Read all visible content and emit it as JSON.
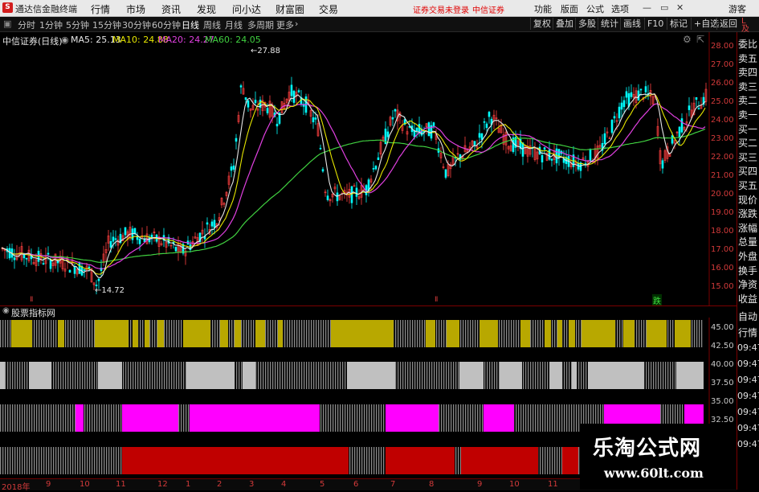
{
  "window": {
    "app_title": "通达信金融终端",
    "menu": [
      "行情",
      "市场",
      "资讯",
      "发现",
      "问小达",
      "财富圈",
      "交易"
    ],
    "notice": "证券交易未登录",
    "broker": "中信证券",
    "right_menu": [
      "功能",
      "版面",
      "公式",
      "选项"
    ],
    "user": "游客"
  },
  "toolbar": {
    "periods": [
      "分时",
      "1分钟",
      "5分钟",
      "15分钟",
      "30分钟",
      "60分钟",
      "日线",
      "周线",
      "月线",
      "多周期",
      "更多"
    ],
    "active_period": "日线",
    "right_buttons": [
      "复权",
      "叠加",
      "多股",
      "统计",
      "画线",
      "F10",
      "标记",
      "+自选",
      "返回"
    ]
  },
  "chart_header": {
    "stock": "中信证券(日线)",
    "ma": [
      {
        "label": "MA5: 25.13",
        "color": "#e6e6e6"
      },
      {
        "label": "MA10: 24.88",
        "color": "#e6e600"
      },
      {
        "label": "MA20: 24.27",
        "color": "#e040e0"
      },
      {
        "label": "MA60: 24.05",
        "color": "#40d040"
      }
    ]
  },
  "price_axis": [
    "28.00",
    "27.00",
    "26.00",
    "25.00",
    "24.00",
    "23.00",
    "22.00",
    "21.00",
    "20.00",
    "19.00",
    "18.00",
    "17.00",
    "16.00",
    "15.00"
  ],
  "annotations": {
    "high": "27.88",
    "low": "14.72",
    "marker": "跌"
  },
  "indicator_panel": {
    "title": "股票指标网"
  },
  "indicator_axis": [
    "45.00",
    "42.50",
    "40.00",
    "37.50",
    "35.00",
    "32.50"
  ],
  "side_labels": [
    "委比",
    "卖五",
    "卖四",
    "卖三",
    "卖二",
    "卖一",
    "买一",
    "买二",
    "买三",
    "买四",
    "买五",
    "现价",
    "涨跌",
    "涨幅",
    "总量",
    "外盘",
    "换手",
    "净资",
    "收益"
  ],
  "side_bottom": [
    "自动",
    "行情"
  ],
  "times": [
    "09:47",
    "09:47",
    "09:47",
    "09:47",
    "09:47",
    "09:47",
    "09:47"
  ],
  "date_axis": [
    "2018年",
    "9",
    "10",
    "11",
    "12",
    "1",
    "2",
    "3",
    "4",
    "5",
    "6",
    "7",
    "8",
    "9",
    "10",
    "11"
  ],
  "watermark": {
    "name": "乐淘公式网",
    "url": "www.60lt.com"
  },
  "colors": {
    "up": "#ff4040",
    "down": "#00ffff",
    "ma5": "#e6e6e6",
    "ma10": "#e6e600",
    "ma20": "#e040e0",
    "ma60": "#40d040",
    "olive": "#b8a800",
    "silver": "#c0c0c0",
    "magenta": "#ff00ff",
    "red": "#c00000"
  }
}
